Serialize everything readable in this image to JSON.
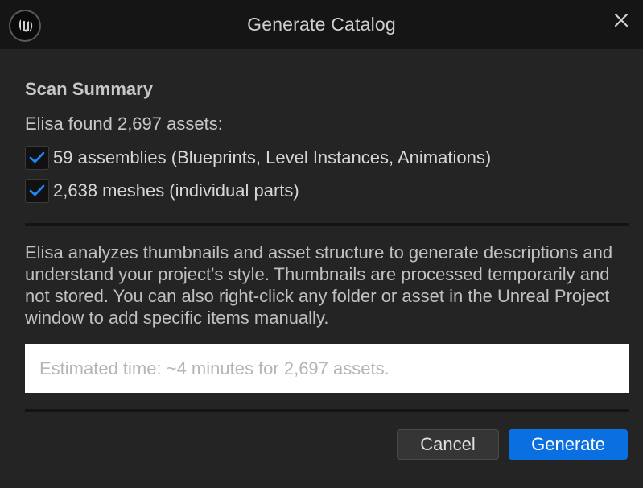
{
  "window": {
    "title": "Generate Catalog",
    "logo_icon": "unreal-logo-icon",
    "close_icon": "close-icon"
  },
  "summary": {
    "heading": "Scan Summary",
    "found_text": "Elisa found 2,697 assets:",
    "options": [
      {
        "label": "59 assemblies (Blueprints, Level Instances, Animations)",
        "checked": true
      },
      {
        "label": "2,638 meshes (individual parts)",
        "checked": true
      }
    ]
  },
  "description": "Elisa analyzes thumbnails and asset structure to generate descriptions and understand your project's style. Thumbnails are processed temporarily and not stored. You can also right-click any folder or asset in the Unreal Project window to add specific items manually.",
  "estimate": "Estimated time: ~4 minutes for 2,697 assets.",
  "buttons": {
    "cancel": "Cancel",
    "generate": "Generate"
  },
  "colors": {
    "accent": "#0a6fe0",
    "check": "#1e88ff",
    "background": "#242424",
    "titlebar": "#151515"
  }
}
